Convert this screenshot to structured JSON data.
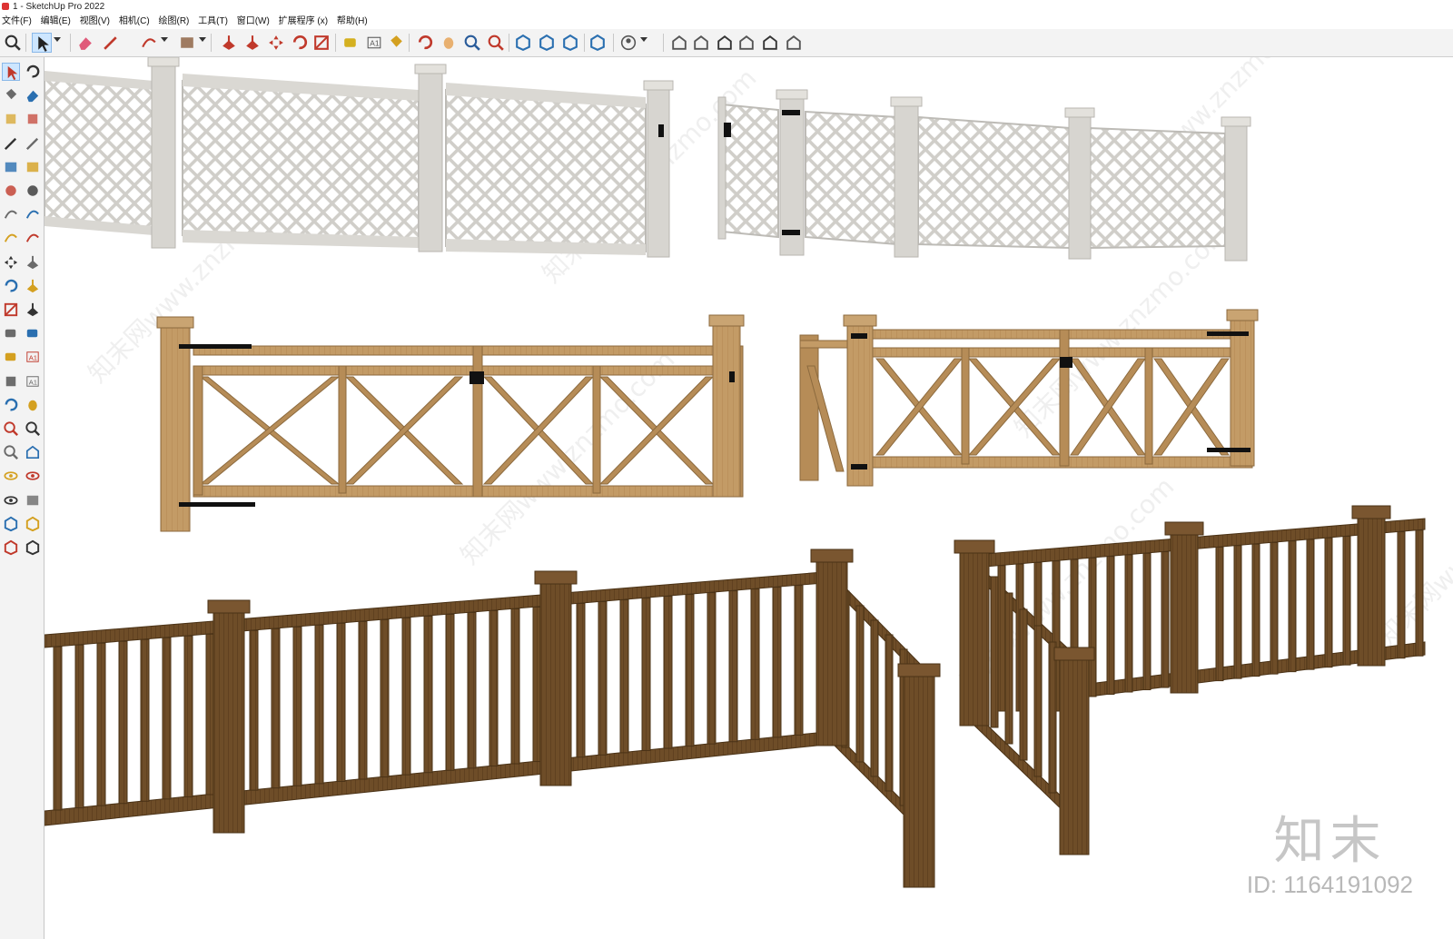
{
  "window": {
    "title": "1 - SketchUp Pro 2022"
  },
  "menu": [
    {
      "id": "file",
      "label": "文件(F)"
    },
    {
      "id": "edit",
      "label": "编辑(E)"
    },
    {
      "id": "view",
      "label": "视图(V)"
    },
    {
      "id": "camera",
      "label": "相机(C)"
    },
    {
      "id": "draw",
      "label": "绘图(R)"
    },
    {
      "id": "tools",
      "label": "工具(T)"
    },
    {
      "id": "window",
      "label": "窗口(W)"
    },
    {
      "id": "extensions",
      "label": "扩展程序 (x)"
    },
    {
      "id": "help",
      "label": "帮助(H)"
    }
  ],
  "toolbar": {
    "tools": [
      {
        "name": "zoom-icon",
        "color": "#333333"
      },
      {
        "name": "select-arrow-icon",
        "color": "#222222",
        "selected": true
      },
      {
        "name": "eraser-icon",
        "color": "#e05a7a"
      },
      {
        "name": "pencil-line-icon",
        "color": "#c0392b"
      },
      {
        "name": "arc-icon",
        "color": "#c0392b"
      },
      {
        "name": "rectangle-icon",
        "color": "#8a5c3c"
      },
      {
        "name": "push-pull-icon",
        "color": "#c0392b"
      },
      {
        "name": "follow-me-icon",
        "color": "#c0392b"
      },
      {
        "name": "move-icon",
        "color": "#c0392b"
      },
      {
        "name": "rotate-icon",
        "color": "#c0392b"
      },
      {
        "name": "scale-icon",
        "color": "#c0392b"
      },
      {
        "name": "tape-measure-icon",
        "color": "#d4b020"
      },
      {
        "name": "text-label-icon",
        "color": "#555555"
      },
      {
        "name": "paint-bucket-icon",
        "color": "#d4a020"
      },
      {
        "name": "orbit-icon",
        "color": "#c0392b"
      },
      {
        "name": "pan-hand-icon",
        "color": "#e8b070"
      },
      {
        "name": "zoom-tool-icon",
        "color": "#2a5c9a"
      },
      {
        "name": "zoom-extents-icon",
        "color": "#c0392b"
      },
      {
        "name": "warehouse-icon",
        "color": "#2a6fb0"
      },
      {
        "name": "extension-warehouse-icon",
        "color": "#2a6fb0"
      },
      {
        "name": "layout-icon",
        "color": "#2a6fb0"
      },
      {
        "name": "extension-manager-icon",
        "color": "#2a6fb0"
      },
      {
        "name": "account-icon",
        "color": "#555555"
      },
      {
        "name": "iso-view-icon",
        "color": "#555555"
      },
      {
        "name": "top-view-icon",
        "color": "#555555"
      },
      {
        "name": "front-view-icon",
        "color": "#333333"
      },
      {
        "name": "right-view-icon",
        "color": "#555555"
      },
      {
        "name": "back-view-icon",
        "color": "#333333"
      },
      {
        "name": "left-view-icon",
        "color": "#555555"
      }
    ]
  },
  "large_toolset": [
    "select-icon",
    "orbit-icon",
    "paint-bucket-icon",
    "eraser-icon",
    "make-component-icon",
    "tag-icon",
    "line-icon",
    "freehand-icon",
    "rectangle-icon",
    "rotated-rectangle-icon",
    "circle-icon",
    "polygon-icon",
    "arc-icon",
    "two-point-arc-icon",
    "three-point-arc-icon",
    "pie-icon",
    "move-icon",
    "push-pull-icon",
    "rotate-icon",
    "follow-me-icon",
    "scale-icon",
    "offset-icon",
    "tape-measure-icon",
    "dimension-icon",
    "protractor-icon",
    "text-icon",
    "axes-icon",
    "3d-text-icon",
    "orbit-tool-icon",
    "pan-icon",
    "zoom-icon",
    "zoom-window-icon",
    "zoom-extents-icon",
    "previous-view-icon",
    "position-camera-icon",
    "look-around-icon",
    "walk-icon",
    "section-plane-icon",
    "warehouse-icon",
    "extension-warehouse-icon",
    "layout-icon",
    "extension-manager-icon"
  ],
  "model": {
    "fences": [
      {
        "name": "gray-lattice-fence",
        "color": "#d3d1cc"
      },
      {
        "name": "gray-lattice-fence-with-gate",
        "color": "#d3d1cc"
      },
      {
        "name": "oak-double-gate",
        "color": "#b89060"
      },
      {
        "name": "oak-double-gate-with-side-door",
        "color": "#b89060"
      },
      {
        "name": "walnut-picket-fence-left",
        "color": "#6b4a26"
      },
      {
        "name": "walnut-picket-fence-right",
        "color": "#6b4a26"
      }
    ]
  },
  "watermark": {
    "logo": "知末",
    "id": "ID: 1164191092",
    "diagonal_text": "知末网www.znzmo.com"
  }
}
